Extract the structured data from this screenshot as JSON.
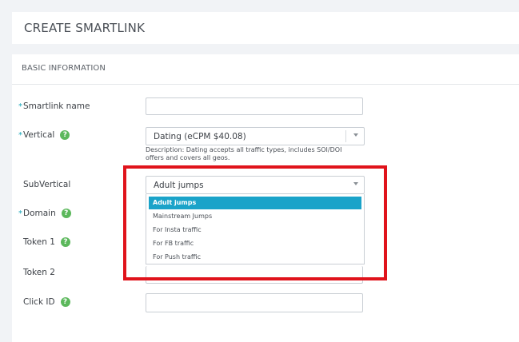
{
  "page": {
    "title": "CREATE SMARTLINK"
  },
  "section": {
    "title": "BASIC INFORMATION"
  },
  "fields": {
    "smartlink_name": {
      "label": "Smartlink name",
      "value": ""
    },
    "vertical": {
      "label": "Vertical",
      "value": "Dating (eCPM $40.08)",
      "description": "Description: Dating accepts all traffic types, includes SOI/DOI offers and covers all geos."
    },
    "subvertical": {
      "label": "SubVertical",
      "value": "Adult jumps"
    },
    "domain": {
      "label": "Domain"
    },
    "token1": {
      "label": "Token 1"
    },
    "token2": {
      "label": "Token 2"
    },
    "click_id": {
      "label": "Click ID",
      "value": ""
    }
  },
  "required_mark": "*",
  "help_glyph": "?",
  "dropdown": {
    "options": [
      "Adult jumps",
      "Mainstream Jumps",
      "For Insta traffic",
      "For FB traffic",
      "For Push traffic"
    ],
    "selected_index": 0
  },
  "colors": {
    "accent": "#1aa3c9",
    "help_icon": "#5cb85c",
    "annotation": "#e0131b",
    "required": "#16a5b8"
  }
}
